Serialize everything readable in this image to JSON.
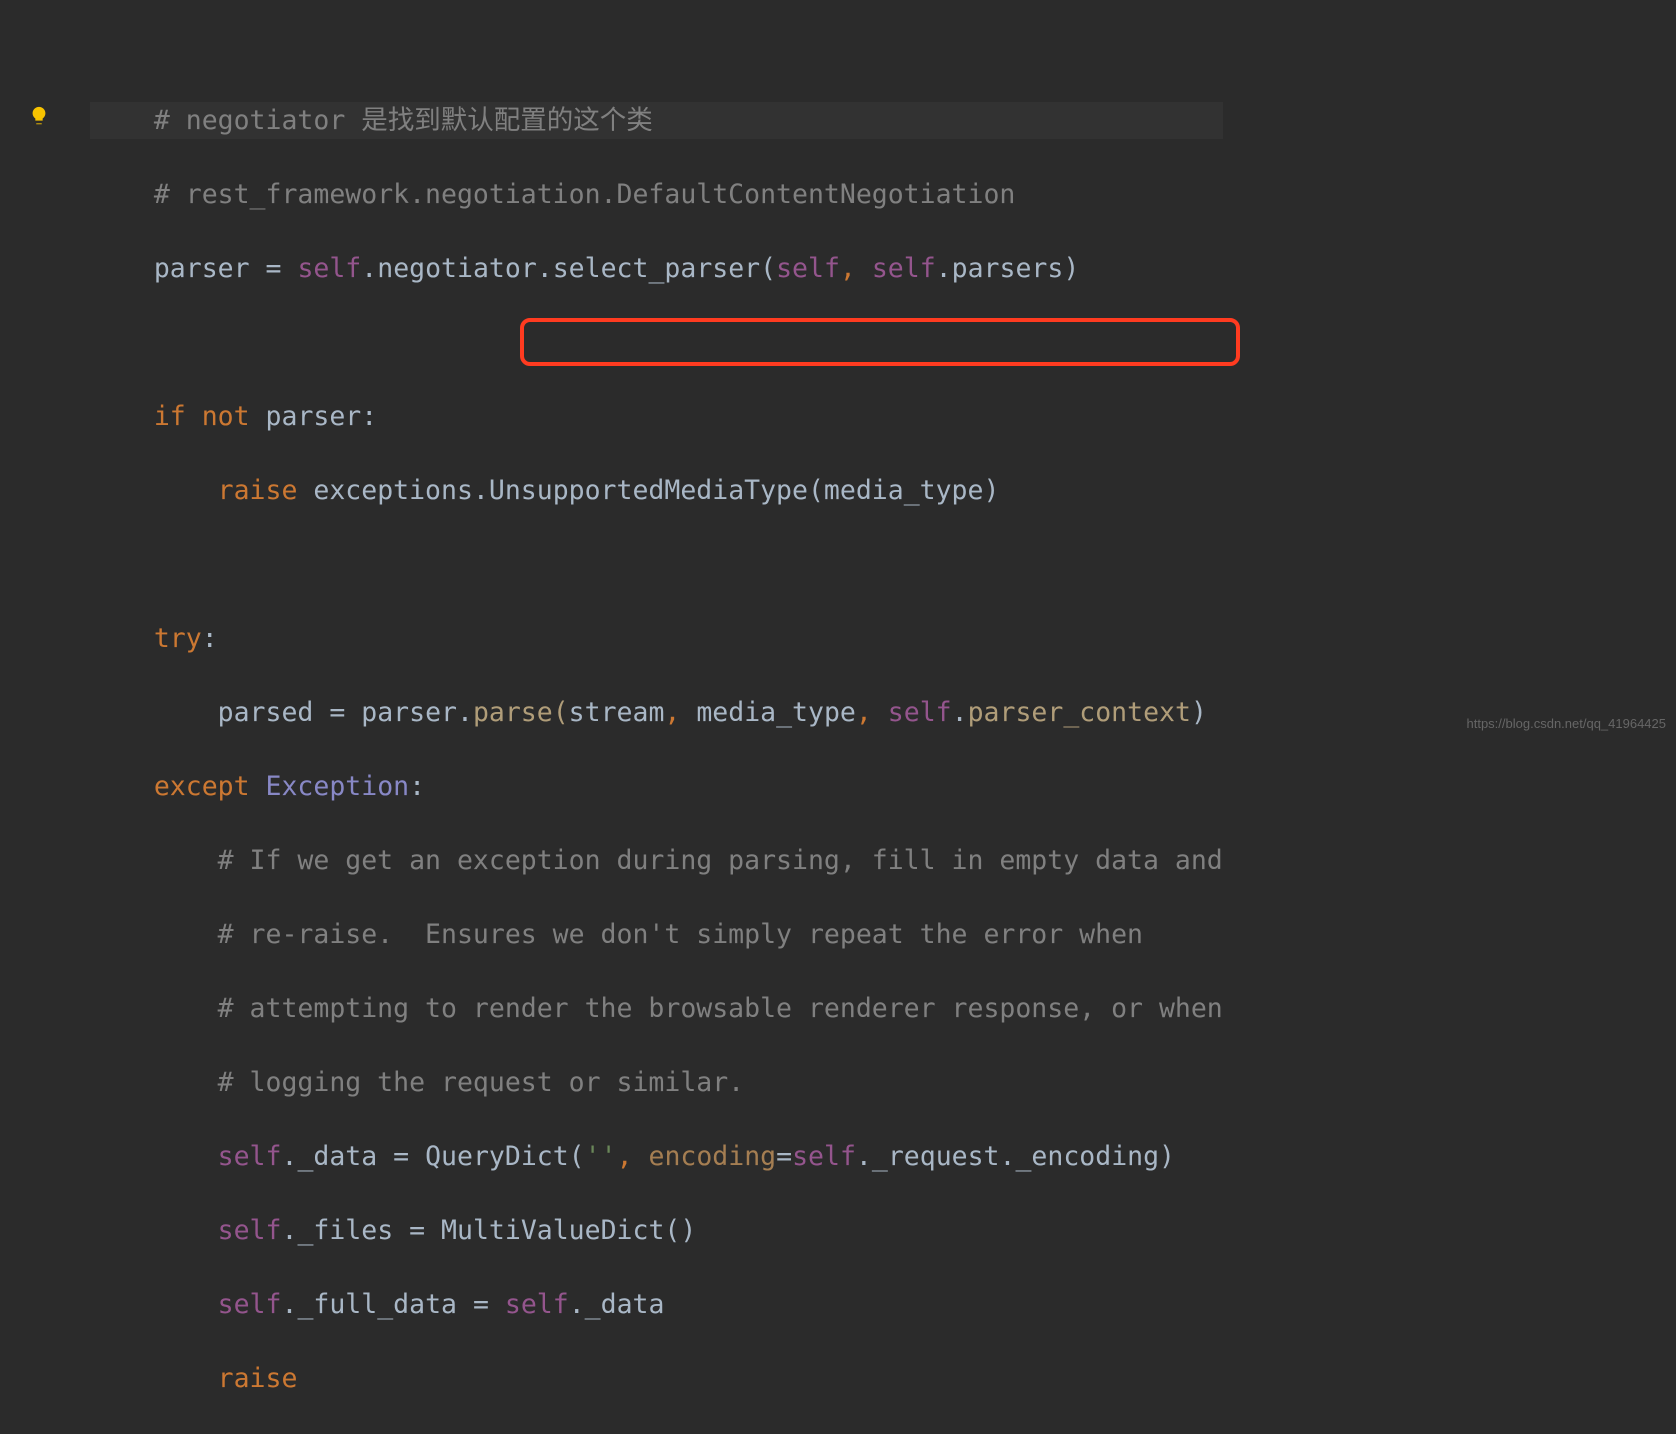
{
  "gutter": {
    "bulb_icon": "lightbulb-icon"
  },
  "code": {
    "line1": {
      "comment": "# negotiator 是找到默认配置的这个类"
    },
    "line2": {
      "comment": "# rest_framework.negotiation.DefaultContentNegotiation"
    },
    "line3": {
      "ident": "parser ",
      "op": "= ",
      "self": "self",
      "dot1": ".",
      "neg": "negotiator.select_parser(",
      "arg_self": "self",
      "comma": ", ",
      "arg_self2": "self",
      "dot2": ".",
      "parsers": "parsers)"
    },
    "line5": {
      "if": "if ",
      "not": "not ",
      "parser": "parser",
      "colon": ":"
    },
    "line6": {
      "raise": "raise ",
      "exc": "exceptions.UnsupportedMediaType(",
      "arg": "media_type",
      "close": ")"
    },
    "line8": {
      "try": "try",
      "colon": ":"
    },
    "line9": {
      "parsed": "parsed ",
      "op": "= ",
      "parser": "parser.",
      "parse": "parse(",
      "stream": "stream",
      "c1": ", ",
      "mt": "media_type",
      "c2": ", ",
      "self": "self",
      "dot": ".",
      "ctx": "parser_context",
      "close": ")"
    },
    "line10": {
      "except": "except ",
      "exception": "Exception",
      "colon": ":"
    },
    "line11": {
      "comment": "# If we get an exception during parsing, fill in empty data and"
    },
    "line12": {
      "comment": "# re-raise.  Ensures we don't simply repeat the error when"
    },
    "line13": {
      "comment": "# attempting to render the browsable renderer response, or when"
    },
    "line14": {
      "comment": "# logging the request or similar."
    },
    "line15": {
      "self": "self",
      "dot": ".",
      "data": "_data ",
      "op": "= ",
      "qd": "QueryDict(",
      "str": "''",
      "c": ", ",
      "kwarg": "encoding",
      "eq": "=",
      "self2": "self",
      "rest": "._request._encoding)"
    },
    "line16": {
      "self": "self",
      "dot": ".",
      "files": "_files ",
      "op": "= ",
      "mvd": "MultiValueDict()"
    },
    "line17": {
      "self": "self",
      "dot": ".",
      "fd": "_full_data ",
      "op": "= ",
      "self2": "self",
      "dot2": ".",
      "d": "_data"
    },
    "line18": {
      "raise": "raise"
    }
  },
  "highlight": {
    "target": "parse(stream, media_type, self.parser_context)"
  },
  "watermark": "https://blog.csdn.net/qq_41964425"
}
